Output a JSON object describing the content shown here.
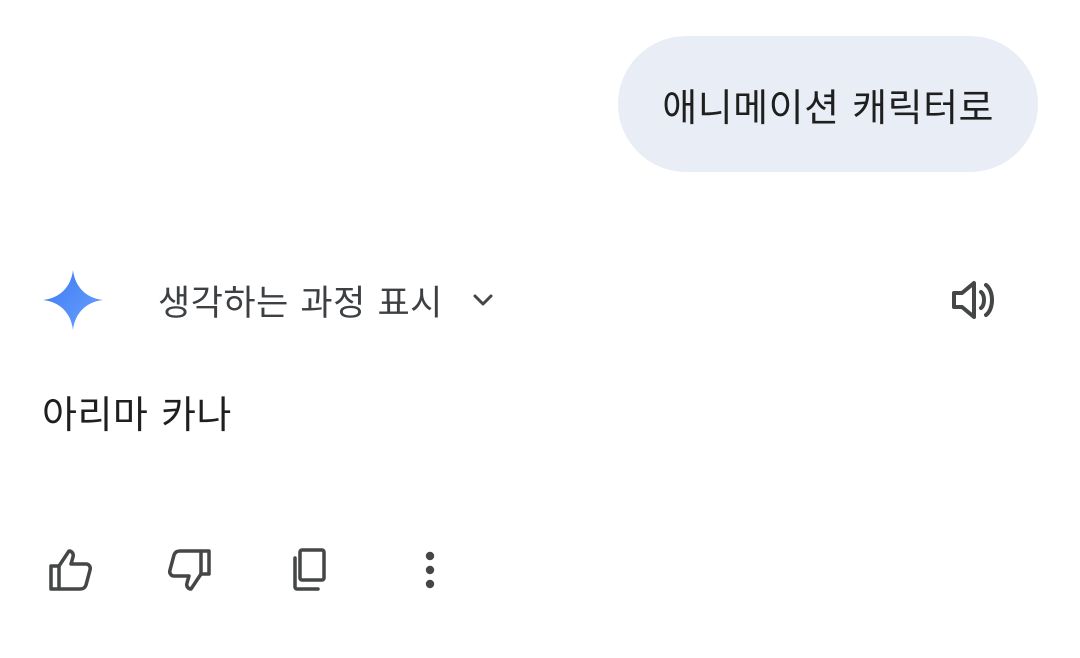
{
  "conversation": {
    "user_message": "애니메이션 캐릭터로",
    "response": {
      "thinking_label": "생각하는 과정 표시",
      "text": "아리마 카나"
    }
  },
  "icons": {
    "assistant": "gemini-sparkle-icon",
    "expand": "chevron-down-icon",
    "read_aloud": "speaker-icon",
    "good": "thumbs-up-icon",
    "bad": "thumbs-down-icon",
    "copy": "copy-icon",
    "more": "more-vert-icon"
  },
  "colors": {
    "user_bubble": "#e9eef6",
    "text": "#1f1f1f",
    "icon": "#444746",
    "sparkle_start": "#4285f4",
    "sparkle_end": "#5b9bff"
  }
}
